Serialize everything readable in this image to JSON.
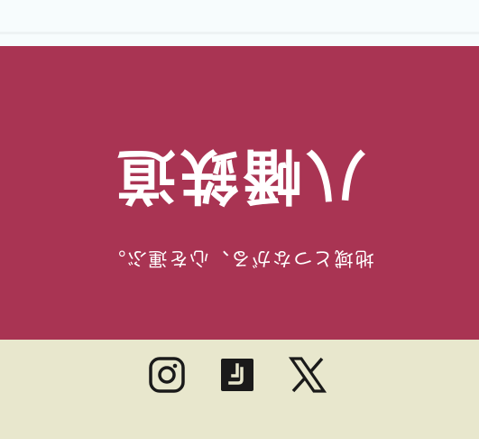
{
  "hero": {
    "title": "八幡鉄道",
    "tagline": "地域とつながる、心を運ぶ。",
    "background_color": "#a93453",
    "text_color": "#ffffff"
  },
  "footer": {
    "background_color": "#e8e7cd",
    "social_links": [
      {
        "name": "instagram",
        "icon": "instagram-icon"
      },
      {
        "name": "note",
        "icon": "note-icon"
      },
      {
        "name": "x",
        "icon": "x-icon"
      }
    ]
  },
  "colors": {
    "page_background": "#f7fcfd",
    "icon_color": "#1a1a1a"
  }
}
